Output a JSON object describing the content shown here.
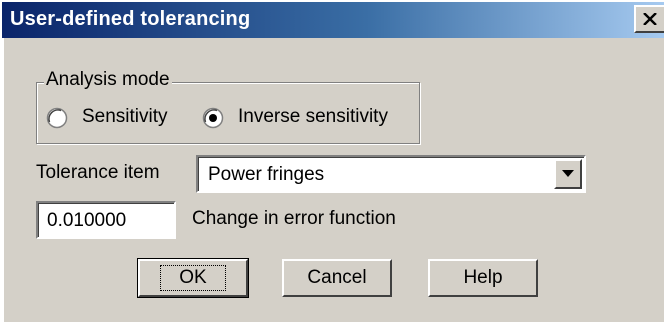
{
  "window": {
    "title": "User-defined tolerancing",
    "close_icon": "close-icon"
  },
  "analysis_mode": {
    "group_label": "Analysis mode",
    "options": [
      {
        "label": "Sensitivity",
        "selected": false
      },
      {
        "label": "Inverse sensitivity",
        "selected": true
      }
    ]
  },
  "tolerance_item": {
    "label": "Tolerance item",
    "value": "Power fringes",
    "dropdown_icon": "chevron-down-icon"
  },
  "error_function": {
    "value": "0.010000",
    "label": "Change in error function"
  },
  "buttons": {
    "ok": "OK",
    "cancel": "Cancel",
    "help": "Help"
  },
  "colors": {
    "titlebar_start": "#0a246a",
    "titlebar_end": "#a6caf0",
    "face": "#d4d0c8"
  }
}
